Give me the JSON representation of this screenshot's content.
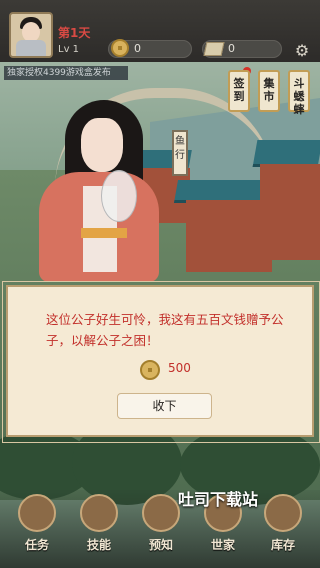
{
  "top": {
    "day_label": "第1天",
    "level_label": "Lv 1",
    "coin_value": "0",
    "ticket_value": "0",
    "notice": "独家授权4399游戏盒发布"
  },
  "side_buttons": {
    "sign_in": "签到",
    "market": "集市",
    "cricket": "斗蟋蟀"
  },
  "scene_signboard": "鱼行",
  "dialog": {
    "message": "这位公子好生可怜，我这有五百文钱赠予公子，以解公子之困！",
    "reward_value": "500",
    "claim_label": "收下"
  },
  "bottom_nav": [
    {
      "label": "任务",
      "icon": "task-scroll-icon"
    },
    {
      "label": "技能",
      "icon": "skill-book-icon"
    },
    {
      "label": "预知",
      "icon": "prophecy-icon"
    },
    {
      "label": "世家",
      "icon": "house-icon"
    },
    {
      "label": "库存",
      "icon": "inventory-box-icon"
    }
  ],
  "watermark": "吐司下载站",
  "colors": {
    "accent_red": "#c2302b",
    "panel_bg": "#f5ead4",
    "gold": "#d8b25d"
  }
}
